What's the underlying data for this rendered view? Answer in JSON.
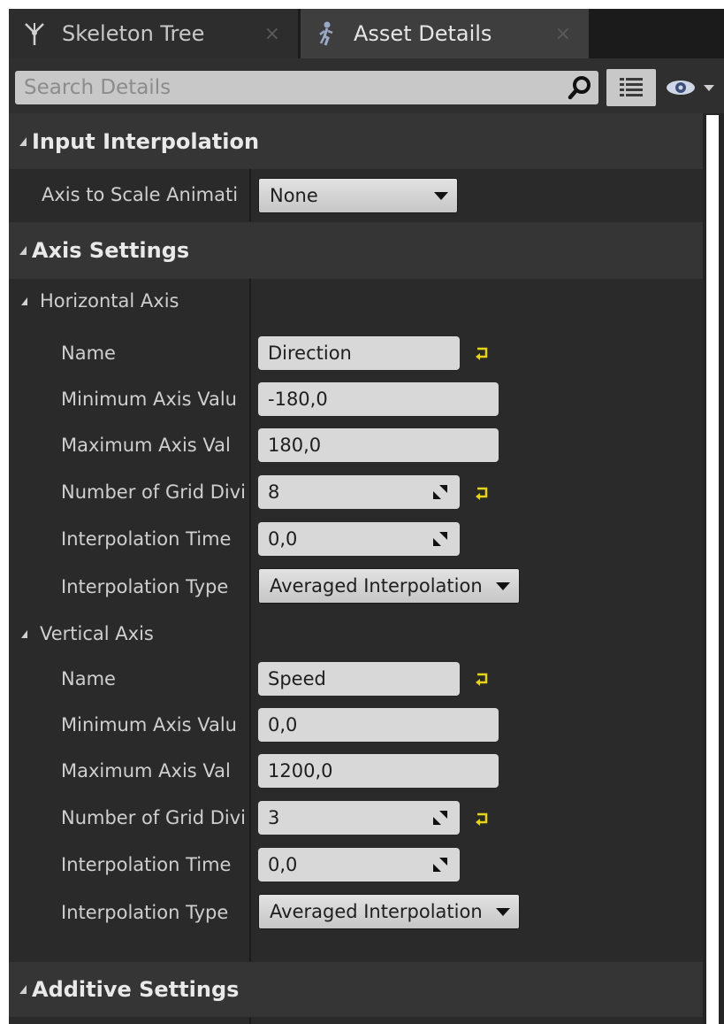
{
  "tabs": [
    {
      "label": "Skeleton Tree",
      "close": "×",
      "icon": "skeleton-tree-icon"
    },
    {
      "label": "Asset Details",
      "close": "×",
      "icon": "asset-details-icon"
    }
  ],
  "search": {
    "placeholder": "Search Details",
    "value": ""
  },
  "sections": {
    "input_interpolation": {
      "title": "Input Interpolation",
      "axis_to_scale": {
        "label": "Axis to Scale Animati",
        "value": "None"
      }
    },
    "axis_settings": {
      "title": "Axis Settings",
      "horizontal": {
        "title": "Horizontal Axis",
        "name": {
          "label": "Name",
          "value": "Direction"
        },
        "min": {
          "label": "Minimum Axis Valu",
          "value": "-180,0"
        },
        "max": {
          "label": "Maximum Axis Val",
          "value": "180,0"
        },
        "grid": {
          "label": "Number of Grid Divi",
          "value": "8"
        },
        "interp_time": {
          "label": "Interpolation Time",
          "value": "0,0"
        },
        "interp_type": {
          "label": "Interpolation Type",
          "value": "Averaged Interpolation"
        }
      },
      "vertical": {
        "title": "Vertical Axis",
        "name": {
          "label": "Name",
          "value": "Speed"
        },
        "min": {
          "label": "Minimum Axis Valu",
          "value": "0,0"
        },
        "max": {
          "label": "Maximum Axis Val",
          "value": "1200,0"
        },
        "grid": {
          "label": "Number of Grid Divi",
          "value": "3"
        },
        "interp_time": {
          "label": "Interpolation Time",
          "value": "0,0"
        },
        "interp_type": {
          "label": "Interpolation Type",
          "value": "Averaged Interpolation"
        }
      }
    },
    "additive_settings": {
      "title": "Additive Settings"
    }
  },
  "colors": {
    "panel_bg": "#252525",
    "section_bg": "#353535",
    "reset_arrow": "#e8d21a",
    "field_bg": "#d8d8d8"
  }
}
